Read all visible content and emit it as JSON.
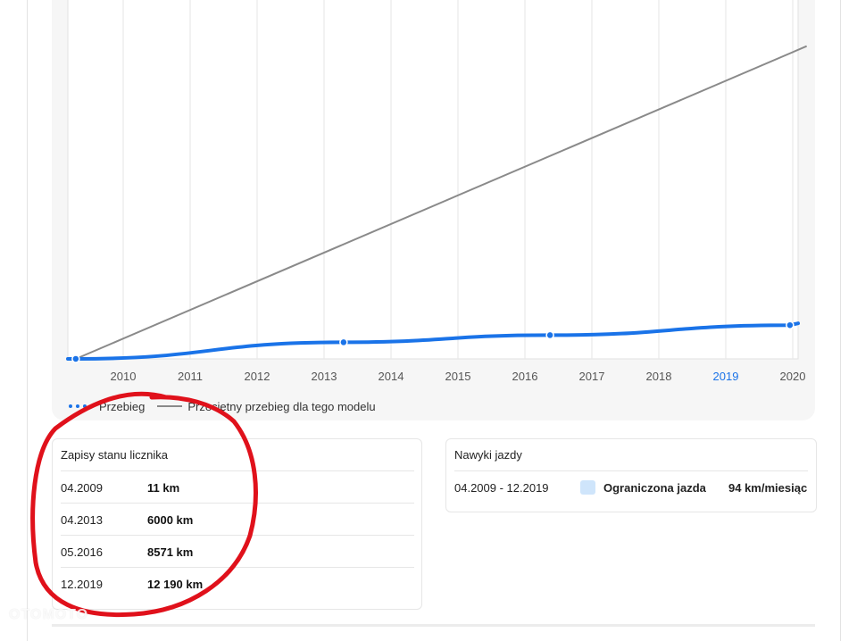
{
  "chart_data": {
    "type": "line",
    "x_ticks": [
      "2010",
      "2011",
      "2012",
      "2013",
      "2014",
      "2015",
      "2016",
      "2017",
      "2018",
      "2019",
      "2020"
    ],
    "highlighted_tick": "2019",
    "series": [
      {
        "name": "Przebieg",
        "color": "#1a73e8",
        "points": [
          {
            "x": "2009-04",
            "y": 11
          },
          {
            "x": "2013-04",
            "y": 6000
          },
          {
            "x": "2016-05",
            "y": 8571
          },
          {
            "x": "2019-12",
            "y": 12190
          }
        ]
      },
      {
        "name": "Przeciętny przebieg dla tego modelu",
        "color": "#8a8a8a",
        "points": [
          {
            "x": "2009-04",
            "y": 0
          },
          {
            "x": "2020-03",
            "y": 113000
          }
        ]
      }
    ],
    "grid": true
  },
  "legend": {
    "items": [
      {
        "label": "Przebieg",
        "color": "#1a73e8"
      },
      {
        "label": "Przeciętny przebieg dla tego modelu",
        "color": "#8a8a8a"
      }
    ]
  },
  "records": {
    "title": "Zapisy stanu licznika",
    "rows": [
      {
        "date": "04.2009",
        "km": "11 km"
      },
      {
        "date": "04.2013",
        "km": "6000 km"
      },
      {
        "date": "05.2016",
        "km": "8571 km"
      },
      {
        "date": "12.2019",
        "km": "12 190 km"
      }
    ]
  },
  "habits": {
    "title": "Nawyki jazdy",
    "period": "04.2009 - 12.2019",
    "type": "Ograniczona jazda",
    "rate": "94 km/miesiąc"
  },
  "watermark": "OTOMOTO",
  "colors": {
    "accent": "#1a73e8",
    "average_line": "#8a8a8a",
    "annotation": "#e0111b"
  }
}
